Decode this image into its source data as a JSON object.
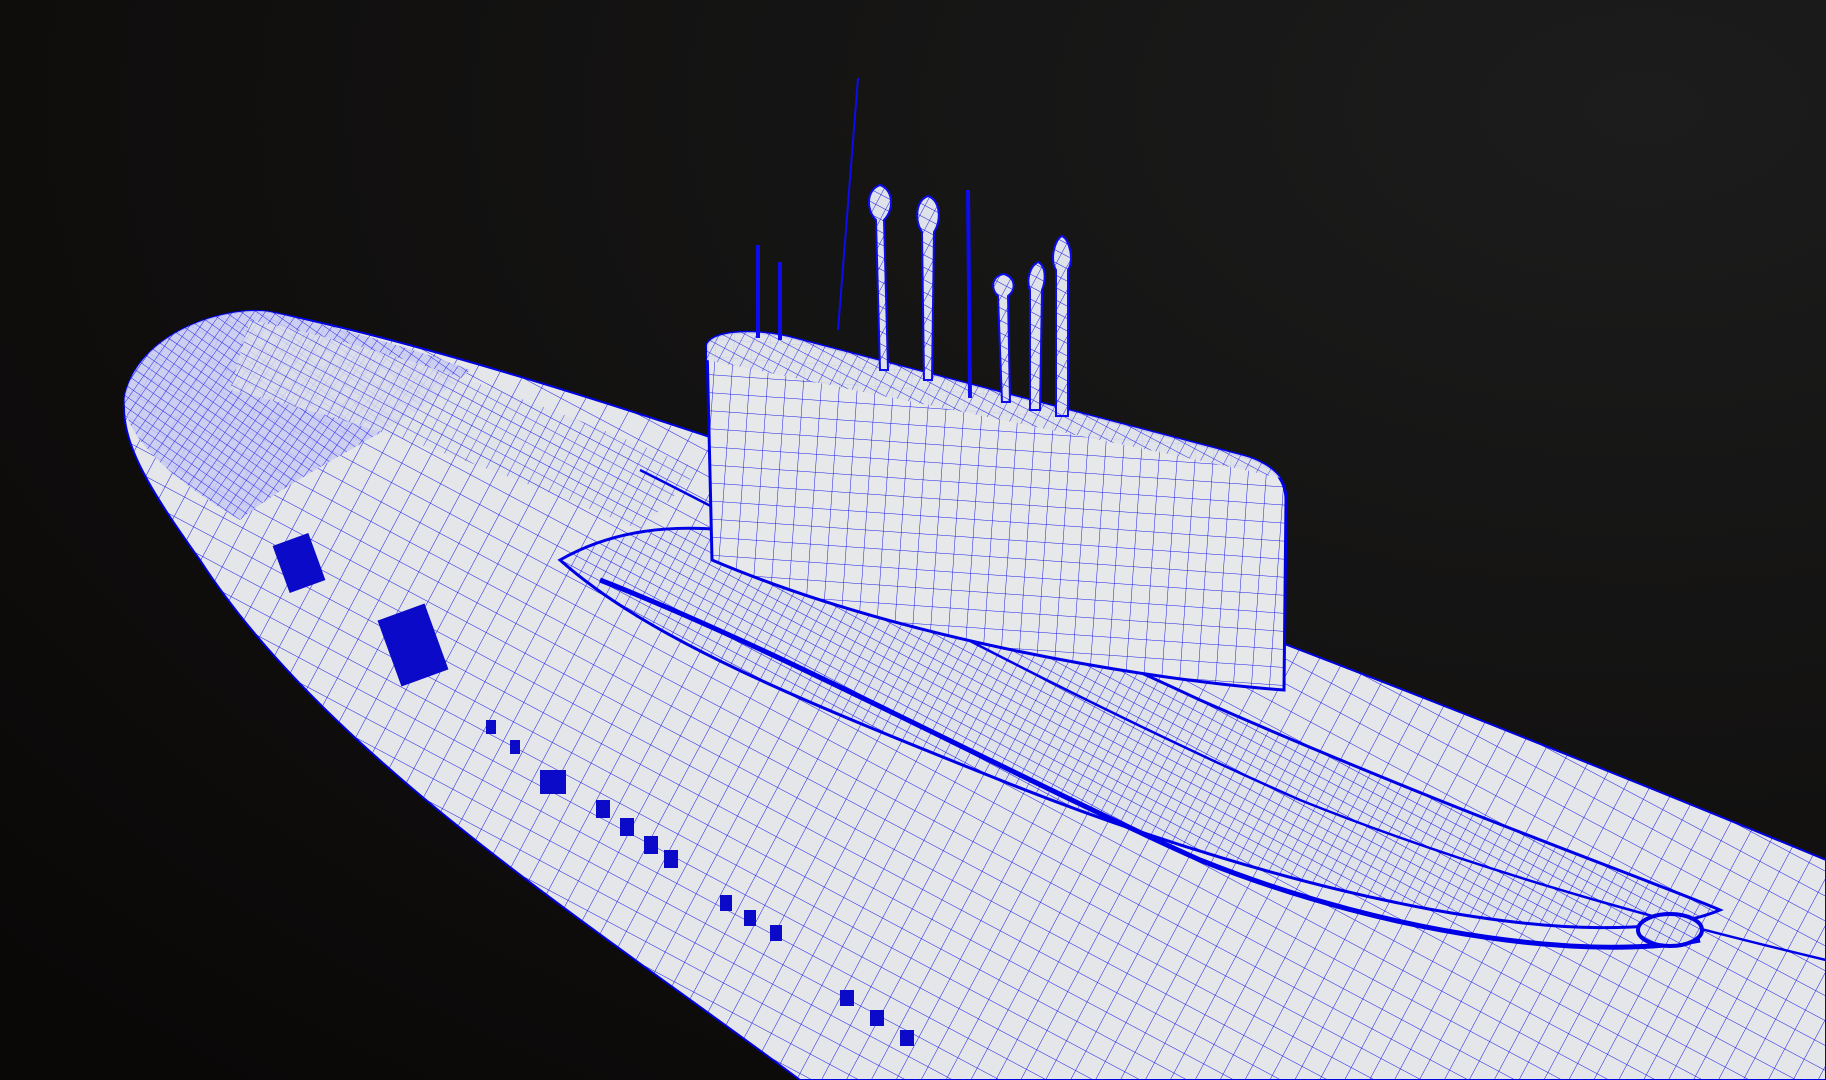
{
  "scene": {
    "subject": "submarine-wireframe-model",
    "colors": {
      "background_top": "#1c1c1c",
      "background_bottom": "#0a0807",
      "hull_fill": "#e4e6e9",
      "wire": "#1010ee",
      "wire_dense": "#0000d8"
    }
  }
}
